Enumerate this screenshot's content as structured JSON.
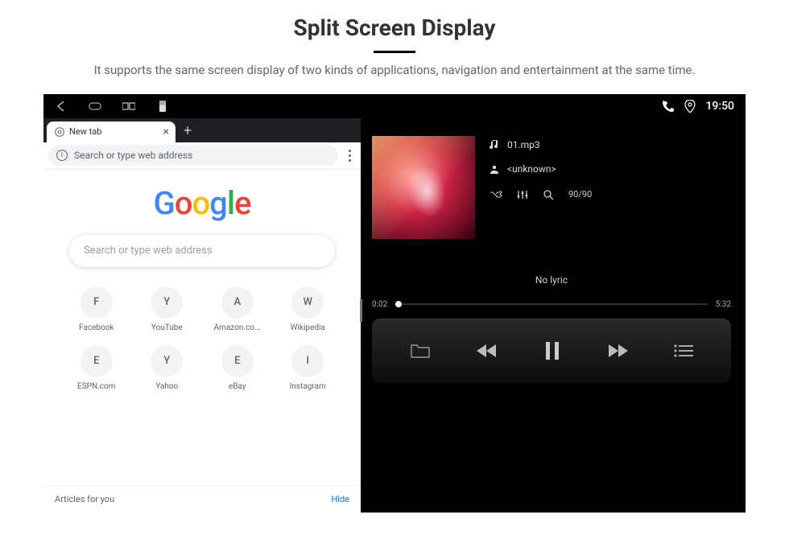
{
  "header": {
    "title": "Split Screen Display",
    "subtitle": "It supports the same screen display of two kinds of applications, navigation and entertainment at the same time."
  },
  "status_bar": {
    "time": "19:50"
  },
  "chrome": {
    "tab_label": "New tab",
    "omnibox_placeholder": "Search or type web address",
    "searchbox_placeholder": "Search or type web address",
    "bookmarks": [
      {
        "letter": "F",
        "label": "Facebook"
      },
      {
        "letter": "Y",
        "label": "YouTube"
      },
      {
        "letter": "A",
        "label": "Amazon.co..."
      },
      {
        "letter": "W",
        "label": "Wikipedia"
      },
      {
        "letter": "E",
        "label": "ESPN.com"
      },
      {
        "letter": "Y",
        "label": "Yahoo"
      },
      {
        "letter": "E",
        "label": "eBay"
      },
      {
        "letter": "I",
        "label": "Instagram"
      }
    ],
    "articles_label": "Articles for you",
    "hide_label": "Hide"
  },
  "player": {
    "track_filename": "01.mp3",
    "artist": "<unknown>",
    "track_position": "90/90",
    "lyric_text": "No lyric",
    "elapsed": "0:02",
    "duration": "5:32"
  }
}
